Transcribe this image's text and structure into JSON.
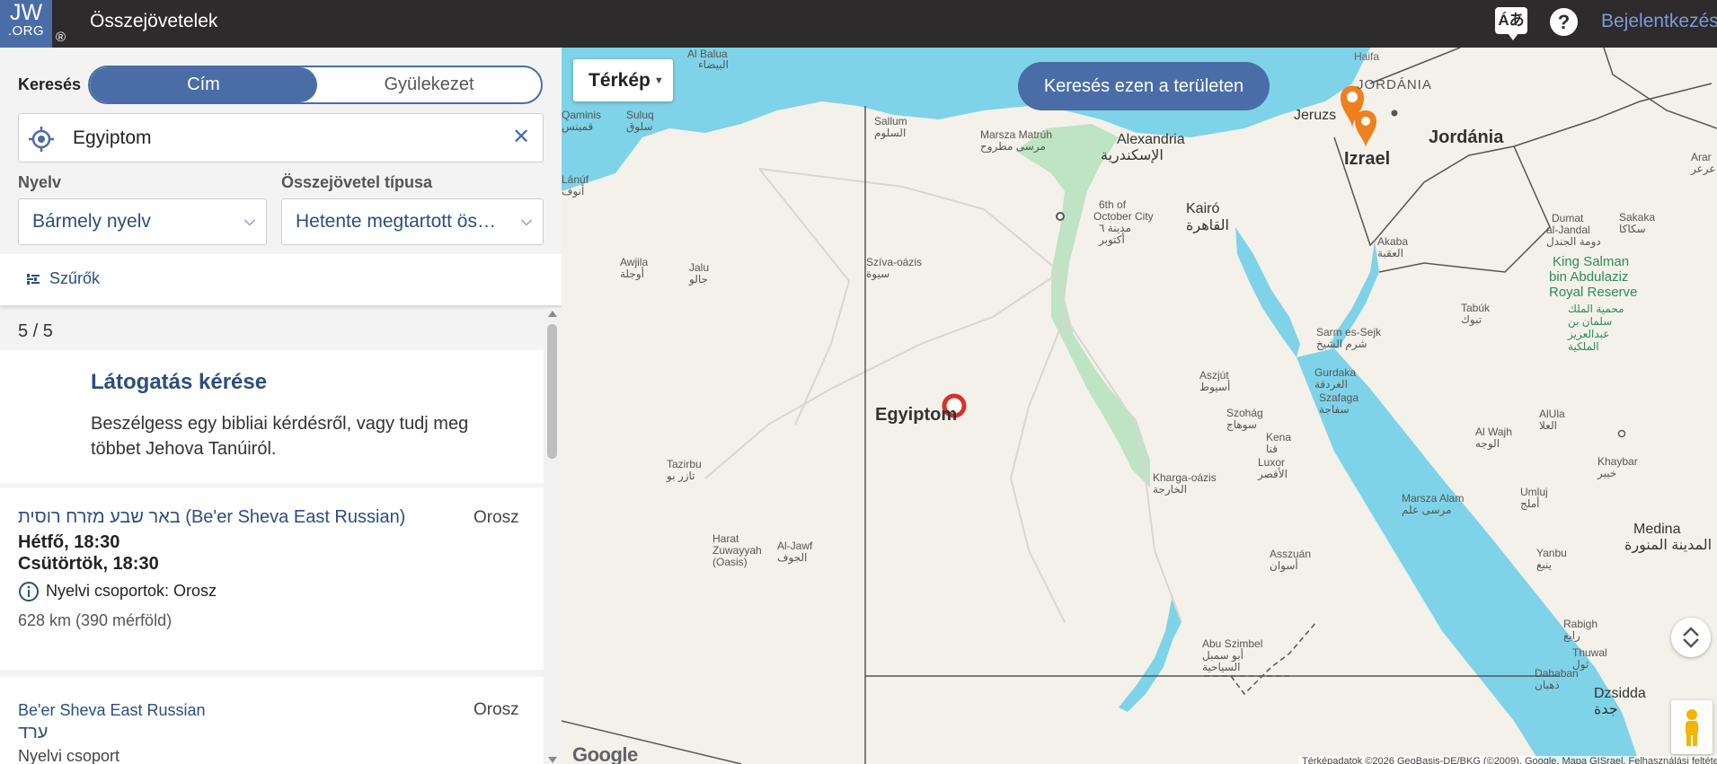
{
  "header": {
    "logo_line1": "JW",
    "logo_line2": ".ORG",
    "logo_reg": "®",
    "title": "Összejövetelek",
    "language_icon_text": "Áあ",
    "help_icon_text": "?",
    "login_label": "Bejelentkezés",
    "icons": [
      "translate-icon",
      "help-icon"
    ]
  },
  "search": {
    "label": "Keresés",
    "modes": [
      "Cím",
      "Gyülekezet"
    ],
    "active_mode": "Cím",
    "value": "Egyiptom",
    "placeholder": "",
    "clear_icon_text": "✕",
    "icons": [
      "target-location-icon",
      "close-icon"
    ]
  },
  "selectors": {
    "language_label": "Nyelv",
    "language_value": "Bármely nyelv",
    "type_label": "Összejövetel típusa",
    "type_value": "Hetente megtartott ös…",
    "chevron": "⌵"
  },
  "filters": {
    "label": "Szűrők",
    "icon": "filter-sliders-icon"
  },
  "results": {
    "count": "5 / 5",
    "visit": {
      "title": "Látogatás kérése",
      "description": "Beszélgess egy bibliai kérdésről, vagy tudj meg többet Jehova Tanúiról."
    },
    "items": [
      {
        "name": "באר שבע מזרח רוסית (Be'er Sheva East Russian)",
        "language": "Orosz",
        "times": [
          "Hétfő, 18:30",
          "Csütörtök, 18:30"
        ],
        "note": "Nyelvi csoportok: Orosz",
        "distance": "628 km (390 mérföld)"
      },
      {
        "name": "Be'er Sheva East Russian",
        "language": "Orosz",
        "subtitle": "ערד",
        "group": "Nyelvi csoport"
      }
    ]
  },
  "map": {
    "type_button": "Térkép",
    "area_search_button": "Keresés ezen a területen",
    "google": "Google",
    "attribution": "Térképadatok ©2026 GeoBasis-DE/BKG (©2009), Google, Mapa GISrael, Felhasználási feltételek",
    "colors": {
      "water": "#7fd3e8",
      "land": "#f3f1ea",
      "nile_green": "#bfe3c5",
      "accent": "#4a6da7",
      "marker_orange": "#f07f1d",
      "marker_red": "#d6322a"
    },
    "labels": {
      "egypt": "Egyiptom",
      "israel": "Izrael",
      "jordan": "Jordánia",
      "jordan_upper": "JORDÁNIA",
      "jerusalem": "Jeruzs",
      "haifa": "Haifa",
      "alexandria": "Alexandria",
      "alexandria_ar": "الإسكندرية",
      "cairo": "Kairó",
      "cairo_ar": "القاهرة",
      "october": "6th of",
      "october2": "October City",
      "october3": "مدينة ٦",
      "october4": "أكتوبر",
      "medina": "Medina",
      "medina_ar": "المدينة المنورة",
      "dzsidda": "Dzsidda",
      "dzsidda_ar": "جدة",
      "sallum": "Sallum",
      "sallum_ar": "السلوم",
      "marsa": "Marsza Matrúh",
      "marsa_ar": "مرسى مطروح",
      "siwa": "Szíva-oázis",
      "siwa_ar": "سيوة",
      "awjila": "Awjila",
      "awjila_ar": "أوجلة",
      "jalu": "Jalu",
      "jalu_ar": "جالو",
      "asyut": "Aszjút",
      "asyut_ar": "أسيوط",
      "sohag": "Szohág",
      "sohag_ar": "سوهاج",
      "qena": "Kena",
      "qena_ar": "قنا",
      "luxor": "Luxor",
      "luxor_ar": "الأقصر",
      "kharga": "Kharga-oázis",
      "kharga_ar": "الخارجة",
      "aswan": "Asszuán",
      "aswan_ar": "أسوان",
      "abusimbel": "Abu Szimbel",
      "abusimbel_ar": "أبو سمبل",
      "abusimbel_ar2": "السياحية",
      "hurghada": "Gurdaka",
      "hurghada_ar": "الغردقة",
      "safaga": "Szafaga",
      "safaga_ar": "سفاجة",
      "marsa_alam": "Marsza Alam",
      "marsa_alam_ar": "مرسى علم",
      "sharm": "Sarm es-Sejk",
      "sharm_ar": "شرم الشيخ",
      "akaba": "Akaba",
      "akaba_ar": "العقبة",
      "tabuk": "Tabúk",
      "tabuk_ar": "تبوك",
      "dumat": "Dumat",
      "dumat2": "al-Jandal",
      "dumat_ar": "دومة الجندل",
      "sakaka": "Sakaka",
      "sakaka_ar": "سكاكا",
      "arar": "Arar",
      "arar_ar": "عرعر",
      "reserve1": "King Salman",
      "reserve2": "bin Abdulaziz",
      "reserve3": "Royal Reserve",
      "reserve_ar1": "محمية الملك",
      "reserve_ar2": "سلمان بن",
      "reserve_ar3": "عبدالعزيز",
      "reserve_ar4": "الملكية",
      "alula": "AlUla",
      "alula_ar": "العلا",
      "alwajh": "Al Wajh",
      "alwajh_ar": "الوجه",
      "khaybar": "Khaybar",
      "khaybar_ar": "خيبر",
      "umluj": "Umluj",
      "umluj_ar": "أملج",
      "yanbu": "Yanbu",
      "yanbu_ar": "ينبع",
      "rabigh": "Rabigh",
      "rabigh_ar": "رابغ",
      "thuwal": "Thuwal",
      "thuwal_ar": "ثول",
      "dahaban": "Dahaban",
      "dahaban_ar": "ذهبان",
      "albalua": "Al Balua",
      "albalua_ar": "البيضاء",
      "qaminis": "Qaminis",
      "qaminis_ar": "قمينس",
      "suluq": "Suluq",
      "suluq_ar": "سلوق",
      "lanuf": "Lánúf",
      "lanuf_ar": "ﺃﻧﻮﻑ",
      "tazirbu": "Tazirbu",
      "tazirbu_ar": "تازر بو",
      "harat1": "Harat",
      "harat2": "Zuwayyah",
      "harat3": "(Oasis)",
      "aljawf": "Al-Jawf",
      "aljawf_ar": "الجوف"
    }
  }
}
